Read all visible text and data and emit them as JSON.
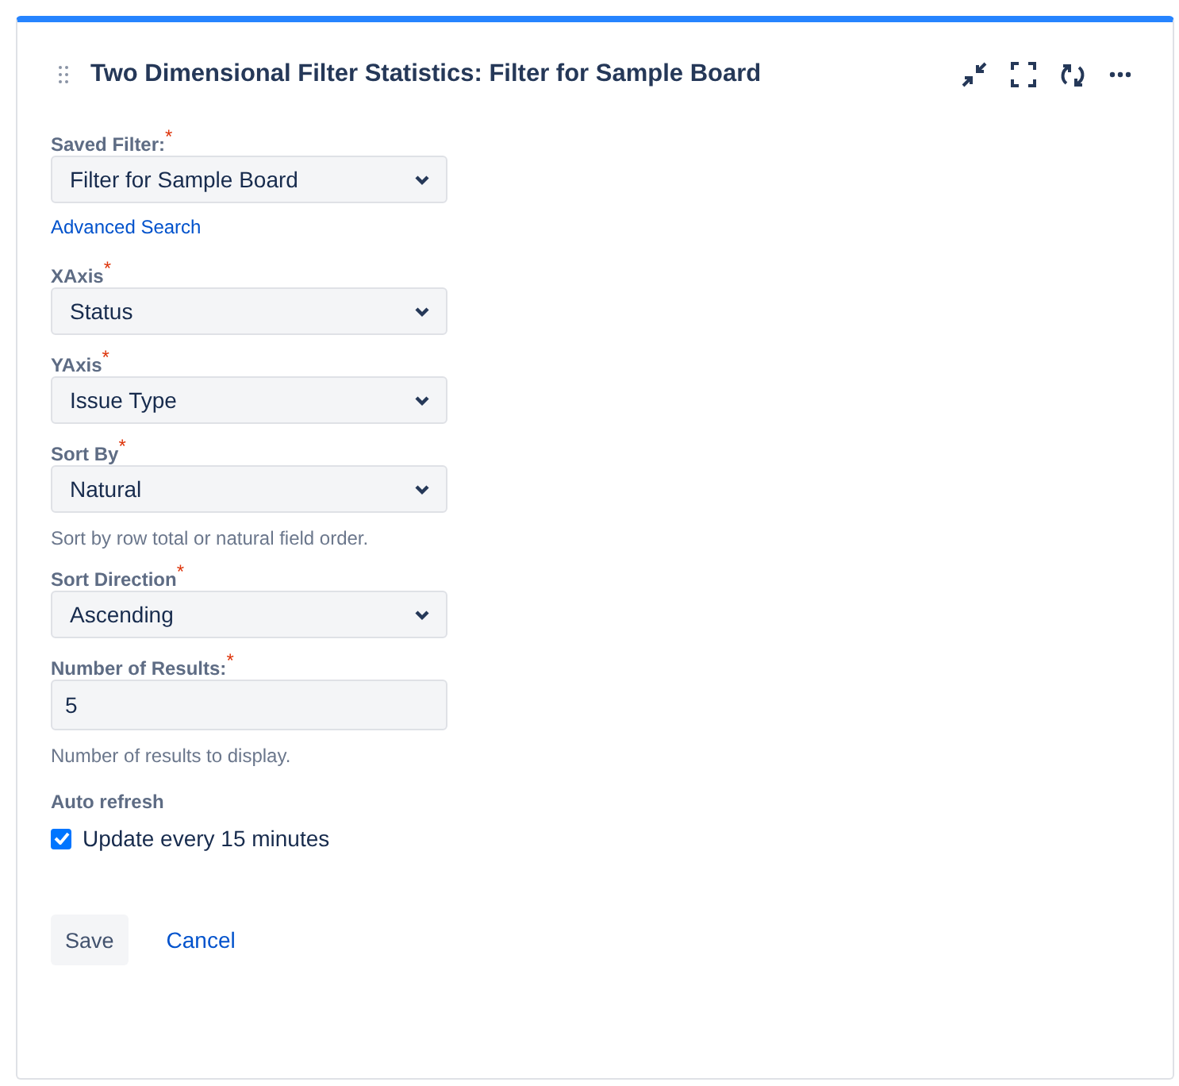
{
  "header": {
    "title": "Two Dimensional Filter Statistics: Filter for Sample Board"
  },
  "fields": [
    {
      "label": "Saved Filter:",
      "required_mark": "*",
      "kind": "select",
      "value": "Filter for Sample Board",
      "link": "Advanced Search"
    },
    {
      "label": "XAxis",
      "required_mark": "*",
      "kind": "select",
      "value": "Status"
    },
    {
      "label": "YAxis",
      "required_mark": "*",
      "kind": "select",
      "value": "Issue Type"
    },
    {
      "label": "Sort By",
      "required_mark": "*",
      "kind": "select",
      "value": "Natural",
      "help": "Sort by row total or natural field order."
    },
    {
      "label": "Sort Direction",
      "required_mark": "*",
      "kind": "select",
      "value": "Ascending"
    },
    {
      "label": "Number of Results:",
      "required_mark": "*",
      "kind": "text",
      "value": "5",
      "help": "Number of results to display."
    }
  ],
  "auto_refresh": {
    "label": "Auto refresh",
    "option": "Update every 15 minutes",
    "checked": true
  },
  "buttons": {
    "save": "Save",
    "cancel": "Cancel"
  }
}
